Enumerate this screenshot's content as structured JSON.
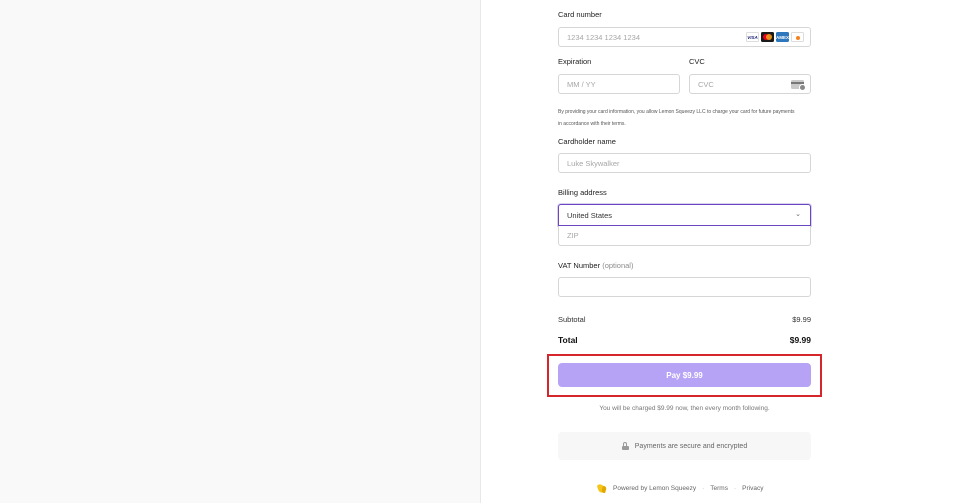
{
  "card": {
    "label": "Card number",
    "placeholder": "1234 1234 1234 1234",
    "brands": [
      "VISA",
      "AMEX"
    ]
  },
  "expiration": {
    "label": "Expiration",
    "placeholder": "MM / YY"
  },
  "cvc": {
    "label": "CVC",
    "placeholder": "CVC"
  },
  "legal": {
    "line1": "By providing your card information, you allow Lemon Squeezy LLC to charge your card for future payments",
    "line2": "in accordance with their terms."
  },
  "cardholder": {
    "label": "Cardholder name",
    "placeholder": "Luke Skywalker"
  },
  "billing": {
    "label": "Billing address",
    "country": "United States",
    "chevron": "⌄",
    "zip_placeholder": "ZIP"
  },
  "vat": {
    "label": "VAT Number",
    "optional": "(optional)"
  },
  "summary": {
    "subtotal_label": "Subtotal",
    "subtotal_value": "$9.99",
    "total_label": "Total",
    "total_value": "$9.99"
  },
  "pay_button": "Pay $9.99",
  "charge_note": "You will be charged $9.99 now, then every month following.",
  "secure_text": "Payments are secure and encrypted",
  "footer": {
    "powered": "Powered by Lemon Squeezy",
    "separator": "·",
    "terms": "Terms",
    "privacy": "Privacy"
  },
  "colors": {
    "accent": "#6b46c1",
    "pay_button": "#b7a3f5",
    "highlight": "#d4262b"
  },
  "icons": [
    "visa-icon",
    "mastercard-icon",
    "amex-icon",
    "discover-icon",
    "cvc-card-icon",
    "chevron-down-icon",
    "lock-icon",
    "lemon-squeezy-logo-icon"
  ]
}
